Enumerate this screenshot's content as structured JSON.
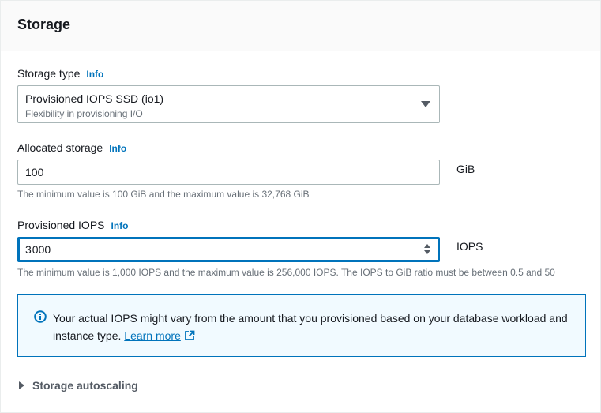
{
  "panel": {
    "title": "Storage"
  },
  "storage_type": {
    "label": "Storage type",
    "info": "Info",
    "selected_value": "Provisioned IOPS SSD (io1)",
    "selected_description": "Flexibility in provisioning I/O"
  },
  "allocated_storage": {
    "label": "Allocated storage",
    "info": "Info",
    "value": "100",
    "unit": "GiB",
    "constraint": "The minimum value is 100 GiB and the maximum value is 32,768 GiB"
  },
  "provisioned_iops": {
    "label": "Provisioned IOPS",
    "info": "Info",
    "value_before_cursor": "3",
    "value_after_cursor": "000",
    "unit": "IOPS",
    "constraint": "The minimum value is 1,000 IOPS and the maximum value is 256,000 IOPS. The IOPS to GiB ratio must be between 0.5 and 50"
  },
  "alert": {
    "type": "info",
    "icon": "info-circle-icon",
    "text": "Your actual IOPS might vary from the amount that you provisioned based on your database workload and instance type.",
    "link_text": "Learn more",
    "link_icon": "external-link-icon"
  },
  "autoscaling": {
    "label": "Storage autoscaling",
    "expanded": false
  },
  "colors": {
    "accent": "#0073bb",
    "alert_background": "#f1faff",
    "border": "#aab7b8",
    "secondary_text": "#687078"
  }
}
